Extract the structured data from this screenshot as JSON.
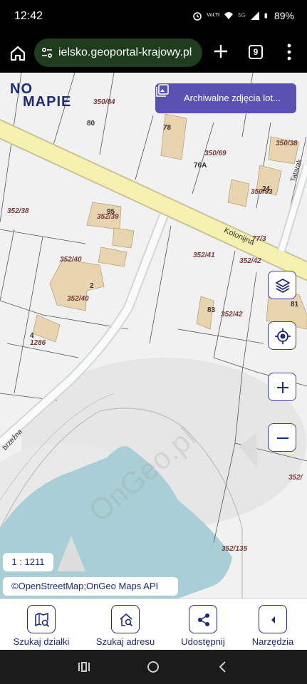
{
  "status": {
    "time": "12:42",
    "network_tag": "5G",
    "volte_tag": "VoLTE",
    "battery": "89%"
  },
  "browser": {
    "url": "ielsko.geoportal-krajowy.pl",
    "tab_count": "9",
    "icons": [
      "home-icon",
      "tune-icon",
      "plus-icon",
      "tabs-icon",
      "more-vert-icon"
    ]
  },
  "map": {
    "logo_top": "NO",
    "logo_bottom": "MAPIE",
    "archive_button": "Archiwalne zdjęcia lot...",
    "scale": "1 : 1211",
    "attribution": "©OpenStreetMap;OnGeo Maps API",
    "street_name": "Kolonijna",
    "street_name_2": "Tatarak",
    "street_name_3": "brzeźna",
    "watermark": "OnGeo.pl",
    "parcels": [
      "350/84",
      "350/69",
      "350/38",
      "350/93",
      "352/38",
      "352/39",
      "352/40",
      "352/40",
      "1286",
      "352/41",
      "352/42",
      "352/42",
      "77/3",
      "352/135",
      "352/"
    ],
    "house_numbers": [
      "80",
      "78",
      "76A",
      "95",
      "2",
      "4",
      "83",
      "81",
      "24"
    ],
    "colors": {
      "brand": "#1e2a7a",
      "archive_bg": "#5a52b0",
      "water": "#a9cfd6",
      "road": "#f6f1b0"
    }
  },
  "toolbar": {
    "items": [
      {
        "label": "Szukaj działki",
        "icon": "map-search-icon"
      },
      {
        "label": "Szukaj adresu",
        "icon": "home-search-icon"
      },
      {
        "label": "Udostępnij",
        "icon": "share-icon"
      },
      {
        "label": "Narzędzia",
        "icon": "chevron-left-icon"
      }
    ]
  }
}
